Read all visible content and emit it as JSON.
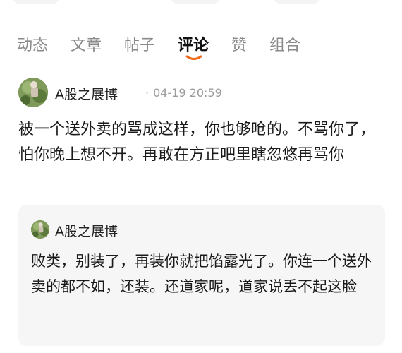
{
  "tabs": [
    {
      "label": "动态",
      "active": false
    },
    {
      "label": "文章",
      "active": false
    },
    {
      "label": "帖子",
      "active": false
    },
    {
      "label": "评论",
      "active": true
    },
    {
      "label": "赞",
      "active": false
    },
    {
      "label": "组合",
      "active": false
    }
  ],
  "accent_color": "#f06a1d",
  "avatar_icon": "avatar-photo-icon",
  "post": {
    "author": "A股之展博",
    "separator": "·",
    "timestamp": "04-19 20:59",
    "text": "被一个送外卖的骂成这样，你也够呛的。不骂你了，怕你晚上想不开。再敢在方正吧里瞎忽悠再骂你"
  },
  "quoted": {
    "author": "A股之展博",
    "text": "败类，别装了，再装你就把馅露光了。你连一个送外卖的都不如，还装。还道家呢，道家说丢不起这脸"
  }
}
